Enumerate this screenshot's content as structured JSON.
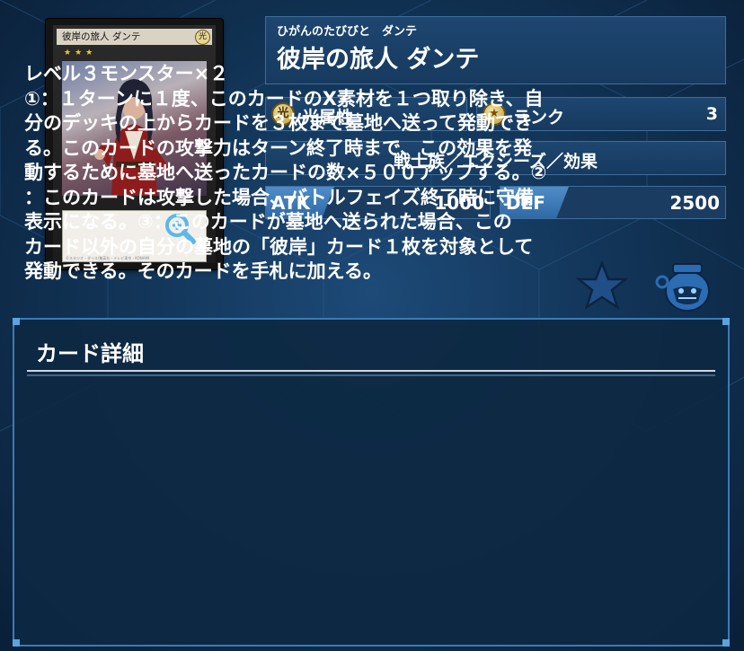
{
  "card": {
    "image_name": "彼岸の旅人 ダンテ",
    "attribute_glyph": "光",
    "stars": "★★★",
    "copyright": "©スタジオ・ダイス/集英社・テレビ東京・KONAMI",
    "zoom_icon": "zoom-in-icon"
  },
  "header": {
    "ruby": "ひがんのたびびと　ダンテ",
    "name": "彼岸の旅人 ダンテ"
  },
  "attribute": {
    "badge": "光",
    "label": "光属性"
  },
  "rank": {
    "badge": "★",
    "label": "ランク",
    "value": "3"
  },
  "type_line": "戦士族／エクシーズ／効果",
  "stats": {
    "atk_label": "ATK",
    "atk_value": "1000",
    "def_label": "DEF",
    "def_value": "2500"
  },
  "actions": {
    "favorite_icon": "star-icon",
    "pot_icon": "pot-of-greed-icon"
  },
  "detail": {
    "title": "カード詳細",
    "text": "レベル３モンスター×２\n①：１ターンに１度、このカードのX素材を１つ取り除き、自\n分のデッキの上からカードを３枚まで墓地へ送って発動でき\nる。このカードの攻撃力はターン終了時まで、この効果を発\n動するために墓地へ送ったカードの数×５００アップする。②\n：このカードは攻撃した場合、バトルフェイズ終了時に守備\n表示になる。③：このカードが墓地へ送られた場合、この\nカード以外の自分の墓地の「彼岸」カード１枚を対象として\n発動できる。そのカードを手札に加える。"
  },
  "colors": {
    "background": "#0e2540",
    "panel_border": "#3b7bb5",
    "stat_tag": "#3f7cba",
    "star_icon": "#1f4f86"
  }
}
